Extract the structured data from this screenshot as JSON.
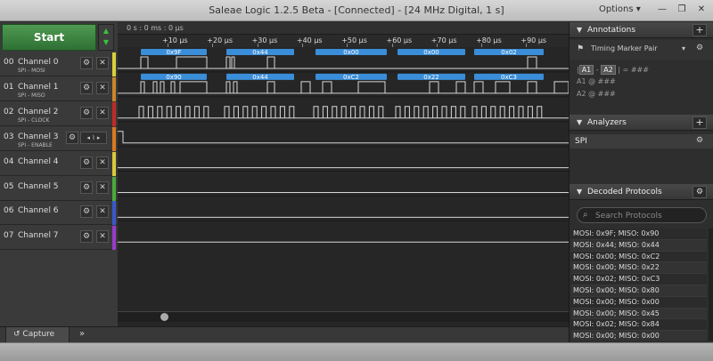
{
  "window": {
    "title": "Saleae Logic 1.2.5 Beta - [Connected] - [24 MHz Digital, 1 s]",
    "options_label": "Options",
    "minimize": "—",
    "restore": "❐",
    "close": "✕"
  },
  "start": {
    "label": "Start"
  },
  "timeline": {
    "origin": "0 s : 0 ms : 0 µs",
    "ticks": [
      "+10 µs",
      "+20 µs",
      "+30 µs",
      "+40 µs",
      "+50 µs",
      "+60 µs",
      "+70 µs",
      "+80 µs",
      "+90 µs"
    ]
  },
  "channels": [
    {
      "num": "00",
      "name": "Channel 0",
      "sub": "SPI - MOSI",
      "color": "#d9cf3a"
    },
    {
      "num": "01",
      "name": "Channel 1",
      "sub": "SPI - MISO",
      "color": "#c9872b"
    },
    {
      "num": "02",
      "name": "Channel 2",
      "sub": "SPI - CLOCK",
      "color": "#c02a2a"
    },
    {
      "num": "03",
      "name": "Channel 3",
      "sub": "SPI - ENABLE",
      "color": "#d97a20"
    },
    {
      "num": "04",
      "name": "Channel 4",
      "sub": "",
      "color": "#d9c93a"
    },
    {
      "num": "05",
      "name": "Channel 5",
      "sub": "",
      "color": "#4ca83a"
    },
    {
      "num": "06",
      "name": "Channel 6",
      "sub": "",
      "color": "#3a58c9"
    },
    {
      "num": "07",
      "name": "Channel 7",
      "sub": "",
      "color": "#9a3ac9"
    }
  ],
  "decoded_labels": {
    "mosi": [
      "0x9F",
      "0x44",
      "0x00",
      "0x00",
      "0x02"
    ],
    "miso": [
      "0x90",
      "0x44",
      "0xC2",
      "0x22",
      "0xC3"
    ]
  },
  "bottom": {
    "capture_tab": "Capture",
    "more": "»"
  },
  "annotations": {
    "header": "Annotations",
    "marker_name": "Timing Marker Pair",
    "line1_a1": "A1",
    "line1_a2": "A2",
    "line1_eq": "= ###",
    "line2": "A1  @  ###",
    "line3": "A2  @  ###"
  },
  "analyzers": {
    "header": "Analyzers",
    "items": [
      {
        "label": "SPI"
      }
    ]
  },
  "decoded": {
    "header": "Decoded Protocols",
    "search_placeholder": "Search Protocols",
    "rows": [
      "MOSI: 0x9F;  MISO: 0x90",
      "MOSI: 0x44;  MISO: 0x44",
      "MOSI: 0x00;  MISO: 0xC2",
      "MOSI: 0x00;  MISO: 0x22",
      "MOSI: 0x02;  MISO: 0xC3",
      "MOSI: 0x00;  MISO: 0x80",
      "MOSI: 0x00;  MISO: 0x00",
      "MOSI: 0x00;  MISO: 0x45",
      "MOSI: 0x02;  MISO: 0x84",
      "MOSI: 0x00;  MISO: 0x00"
    ]
  },
  "colors": {
    "decode_blue": "#3a8ed9",
    "trace": "#d8d8d8",
    "start_green": "#3d8c41"
  }
}
